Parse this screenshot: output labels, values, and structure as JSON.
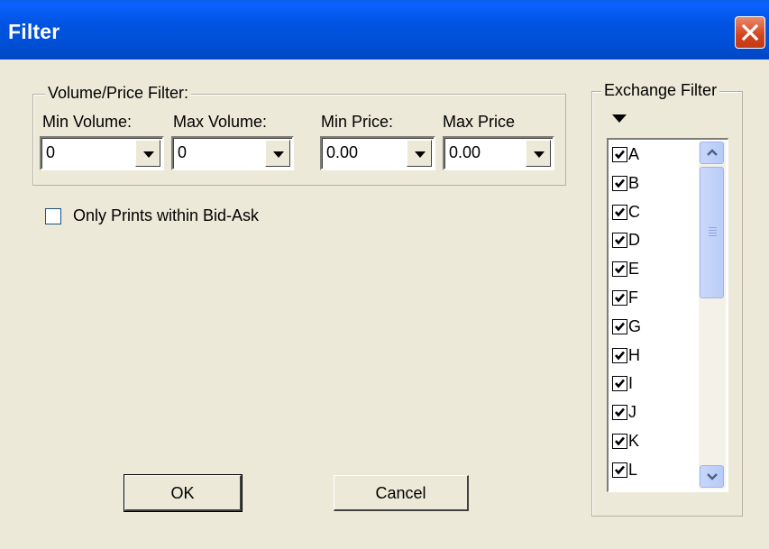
{
  "window": {
    "title": "Filter"
  },
  "volume_price_filter": {
    "legend": "Volume/Price Filter:",
    "min_volume": {
      "label": "Min Volume:",
      "value": "0"
    },
    "max_volume": {
      "label": "Max Volume:",
      "value": "0"
    },
    "min_price": {
      "label": "Min Price:",
      "value": "0.00"
    },
    "max_price": {
      "label": "Max Price",
      "value": "0.00"
    }
  },
  "bid_ask_checkbox": {
    "label": "Only Prints within Bid-Ask",
    "checked": false
  },
  "buttons": {
    "ok": "OK",
    "cancel": "Cancel"
  },
  "exchange_filter": {
    "legend": "Exchange Filter",
    "items": [
      {
        "label": "A",
        "checked": true
      },
      {
        "label": "B",
        "checked": true
      },
      {
        "label": "C",
        "checked": true
      },
      {
        "label": "D",
        "checked": true
      },
      {
        "label": "E",
        "checked": true
      },
      {
        "label": "F",
        "checked": true
      },
      {
        "label": "G",
        "checked": true
      },
      {
        "label": "H",
        "checked": true
      },
      {
        "label": "I",
        "checked": true
      },
      {
        "label": "J",
        "checked": true
      },
      {
        "label": "K",
        "checked": true
      },
      {
        "label": "L",
        "checked": true
      }
    ]
  },
  "icons": {
    "close": "close-icon",
    "dropdown": "triangle-down-icon",
    "check": "checkmark-icon"
  }
}
